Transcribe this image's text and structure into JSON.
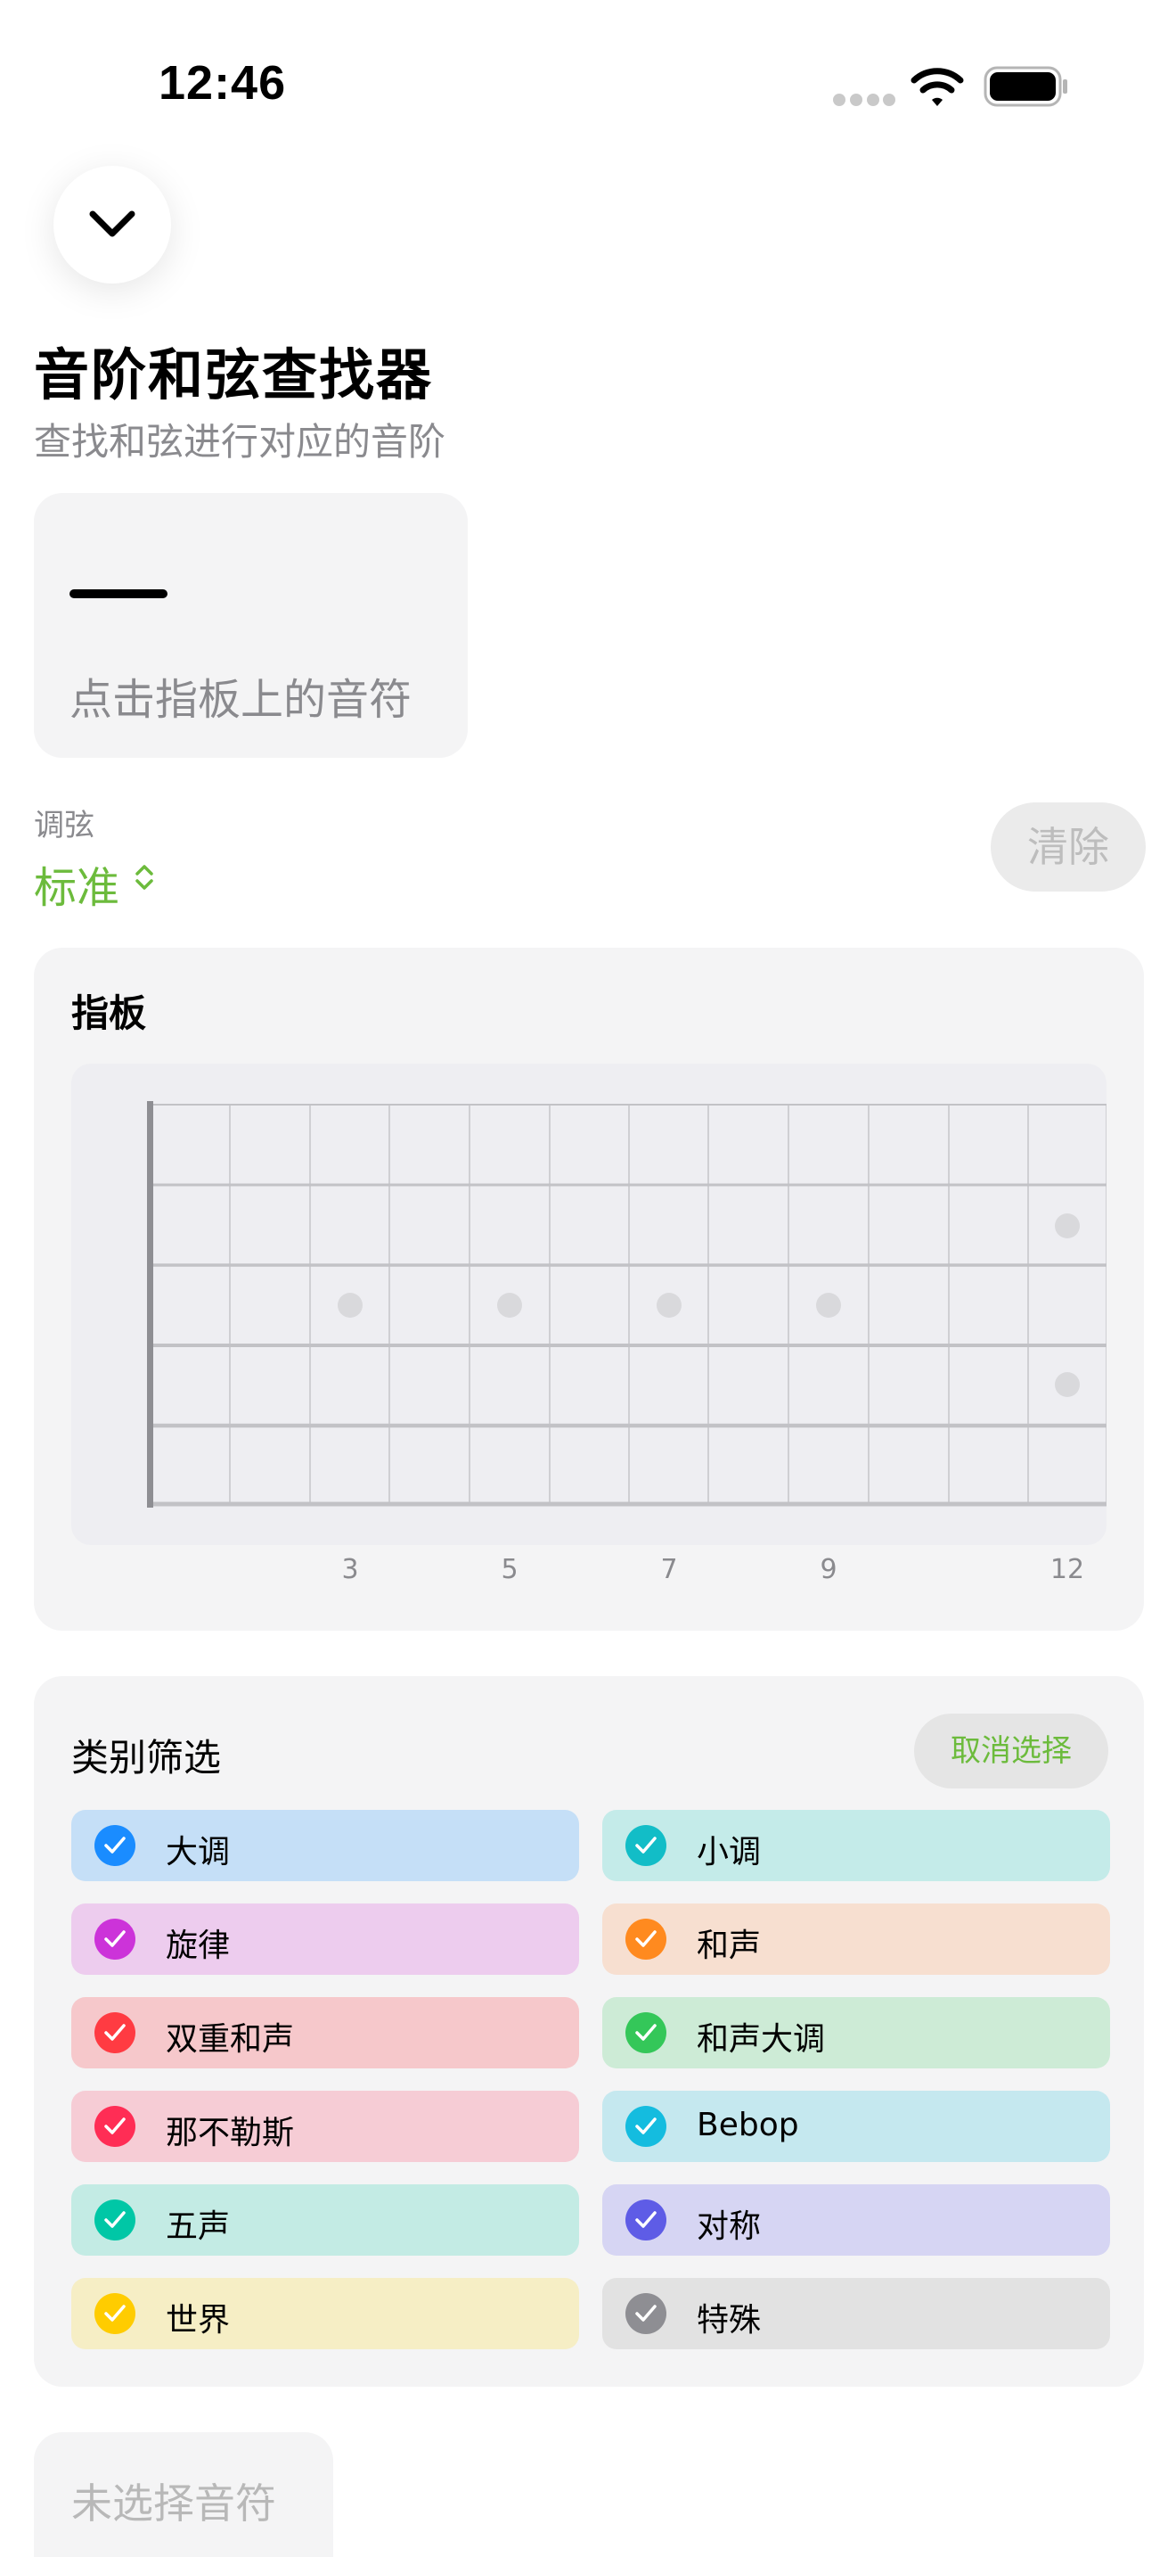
{
  "status_bar": {
    "time": "12:46"
  },
  "header": {
    "title": "音阶和弦查找器",
    "subtitle": "查找和弦进行对应的音阶"
  },
  "chord_card": {
    "value": "—",
    "hint": "点击指板上的音符"
  },
  "tuning": {
    "label": "调弦",
    "value": "标准"
  },
  "clear_button": "清除",
  "fretboard": {
    "title": "指板",
    "fret_labels": [
      "3",
      "5",
      "7",
      "9",
      "12"
    ]
  },
  "filter": {
    "title": "类别筛选",
    "deselect_label": "取消选择",
    "categories": [
      {
        "label": "大调",
        "color": "#1a8cff",
        "bg": "#c5dff7"
      },
      {
        "label": "小调",
        "color": "#12bdc7",
        "bg": "#c4ebe9"
      },
      {
        "label": "旋律",
        "color": "#cc33d9",
        "bg": "#edccee"
      },
      {
        "label": "和声",
        "color": "#ff8a1f",
        "bg": "#f7dfd0"
      },
      {
        "label": "双重和声",
        "color": "#ff3b42",
        "bg": "#f6c8cb"
      },
      {
        "label": "和声大调",
        "color": "#34c759",
        "bg": "#cdebd6"
      },
      {
        "label": "那不勒斯",
        "color": "#ff2d55",
        "bg": "#f6ccd5"
      },
      {
        "label": "Bebop",
        "color": "#14bcdf",
        "bg": "#c5e8ef"
      },
      {
        "label": "五声",
        "color": "#00c7a6",
        "bg": "#c3ebe4"
      },
      {
        "label": "对称",
        "color": "#5e5ce6",
        "bg": "#d6d5f3"
      },
      {
        "label": "世界",
        "color": "#ffcc00",
        "bg": "#f6eec5"
      },
      {
        "label": "特殊",
        "color": "#8e8e93",
        "bg": "#e2e2e2"
      }
    ]
  },
  "bottom": {
    "no_note_label": "未选择音符"
  }
}
